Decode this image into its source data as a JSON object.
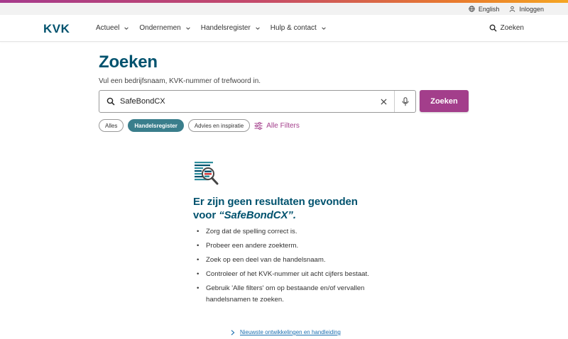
{
  "colors": {
    "brand": "#00526e",
    "accent": "#a33e8b",
    "chip_active": "#3a7e8c",
    "link": "#1a6fb0"
  },
  "utility": {
    "language": {
      "label": "English",
      "icon": "globe-icon"
    },
    "login": {
      "label": "Inloggen",
      "icon": "user-icon"
    }
  },
  "nav": {
    "logo": "KVK",
    "items": [
      {
        "label": "Actueel"
      },
      {
        "label": "Ondernemen"
      },
      {
        "label": "Handelsregister"
      },
      {
        "label": "Hulp & contact"
      }
    ],
    "search_label": "Zoeken"
  },
  "search": {
    "title": "Zoeken",
    "subtitle": "Vul een bedrijfsnaam, KVK-nummer of trefwoord in.",
    "query": "SafeBondCX",
    "button_label": "Zoeken"
  },
  "filters": {
    "chips": [
      {
        "label": "Alles",
        "active": false
      },
      {
        "label": "Handelsregister",
        "active": true
      },
      {
        "label": "Advies en inspiratie",
        "active": false
      }
    ],
    "all_filters_label": "Alle Filters"
  },
  "no_results": {
    "title_prefix": "Er zijn geen resultaten gevonden voor ",
    "title_query": "“SafeBondCX”.",
    "tips": [
      "Zorg dat de spelling correct is.",
      "Probeer een andere zoekterm.",
      "Zoek op een deel van de handelsnaam.",
      "Controleer of het KVK-nummer uit acht cijfers bestaat.",
      "Gebruik 'Alle filters' om op bestaande en/of vervallen handelsnamen te zoeken."
    ]
  },
  "footer_link": {
    "label": "Nieuwste ontwikkelingen en handleiding"
  }
}
